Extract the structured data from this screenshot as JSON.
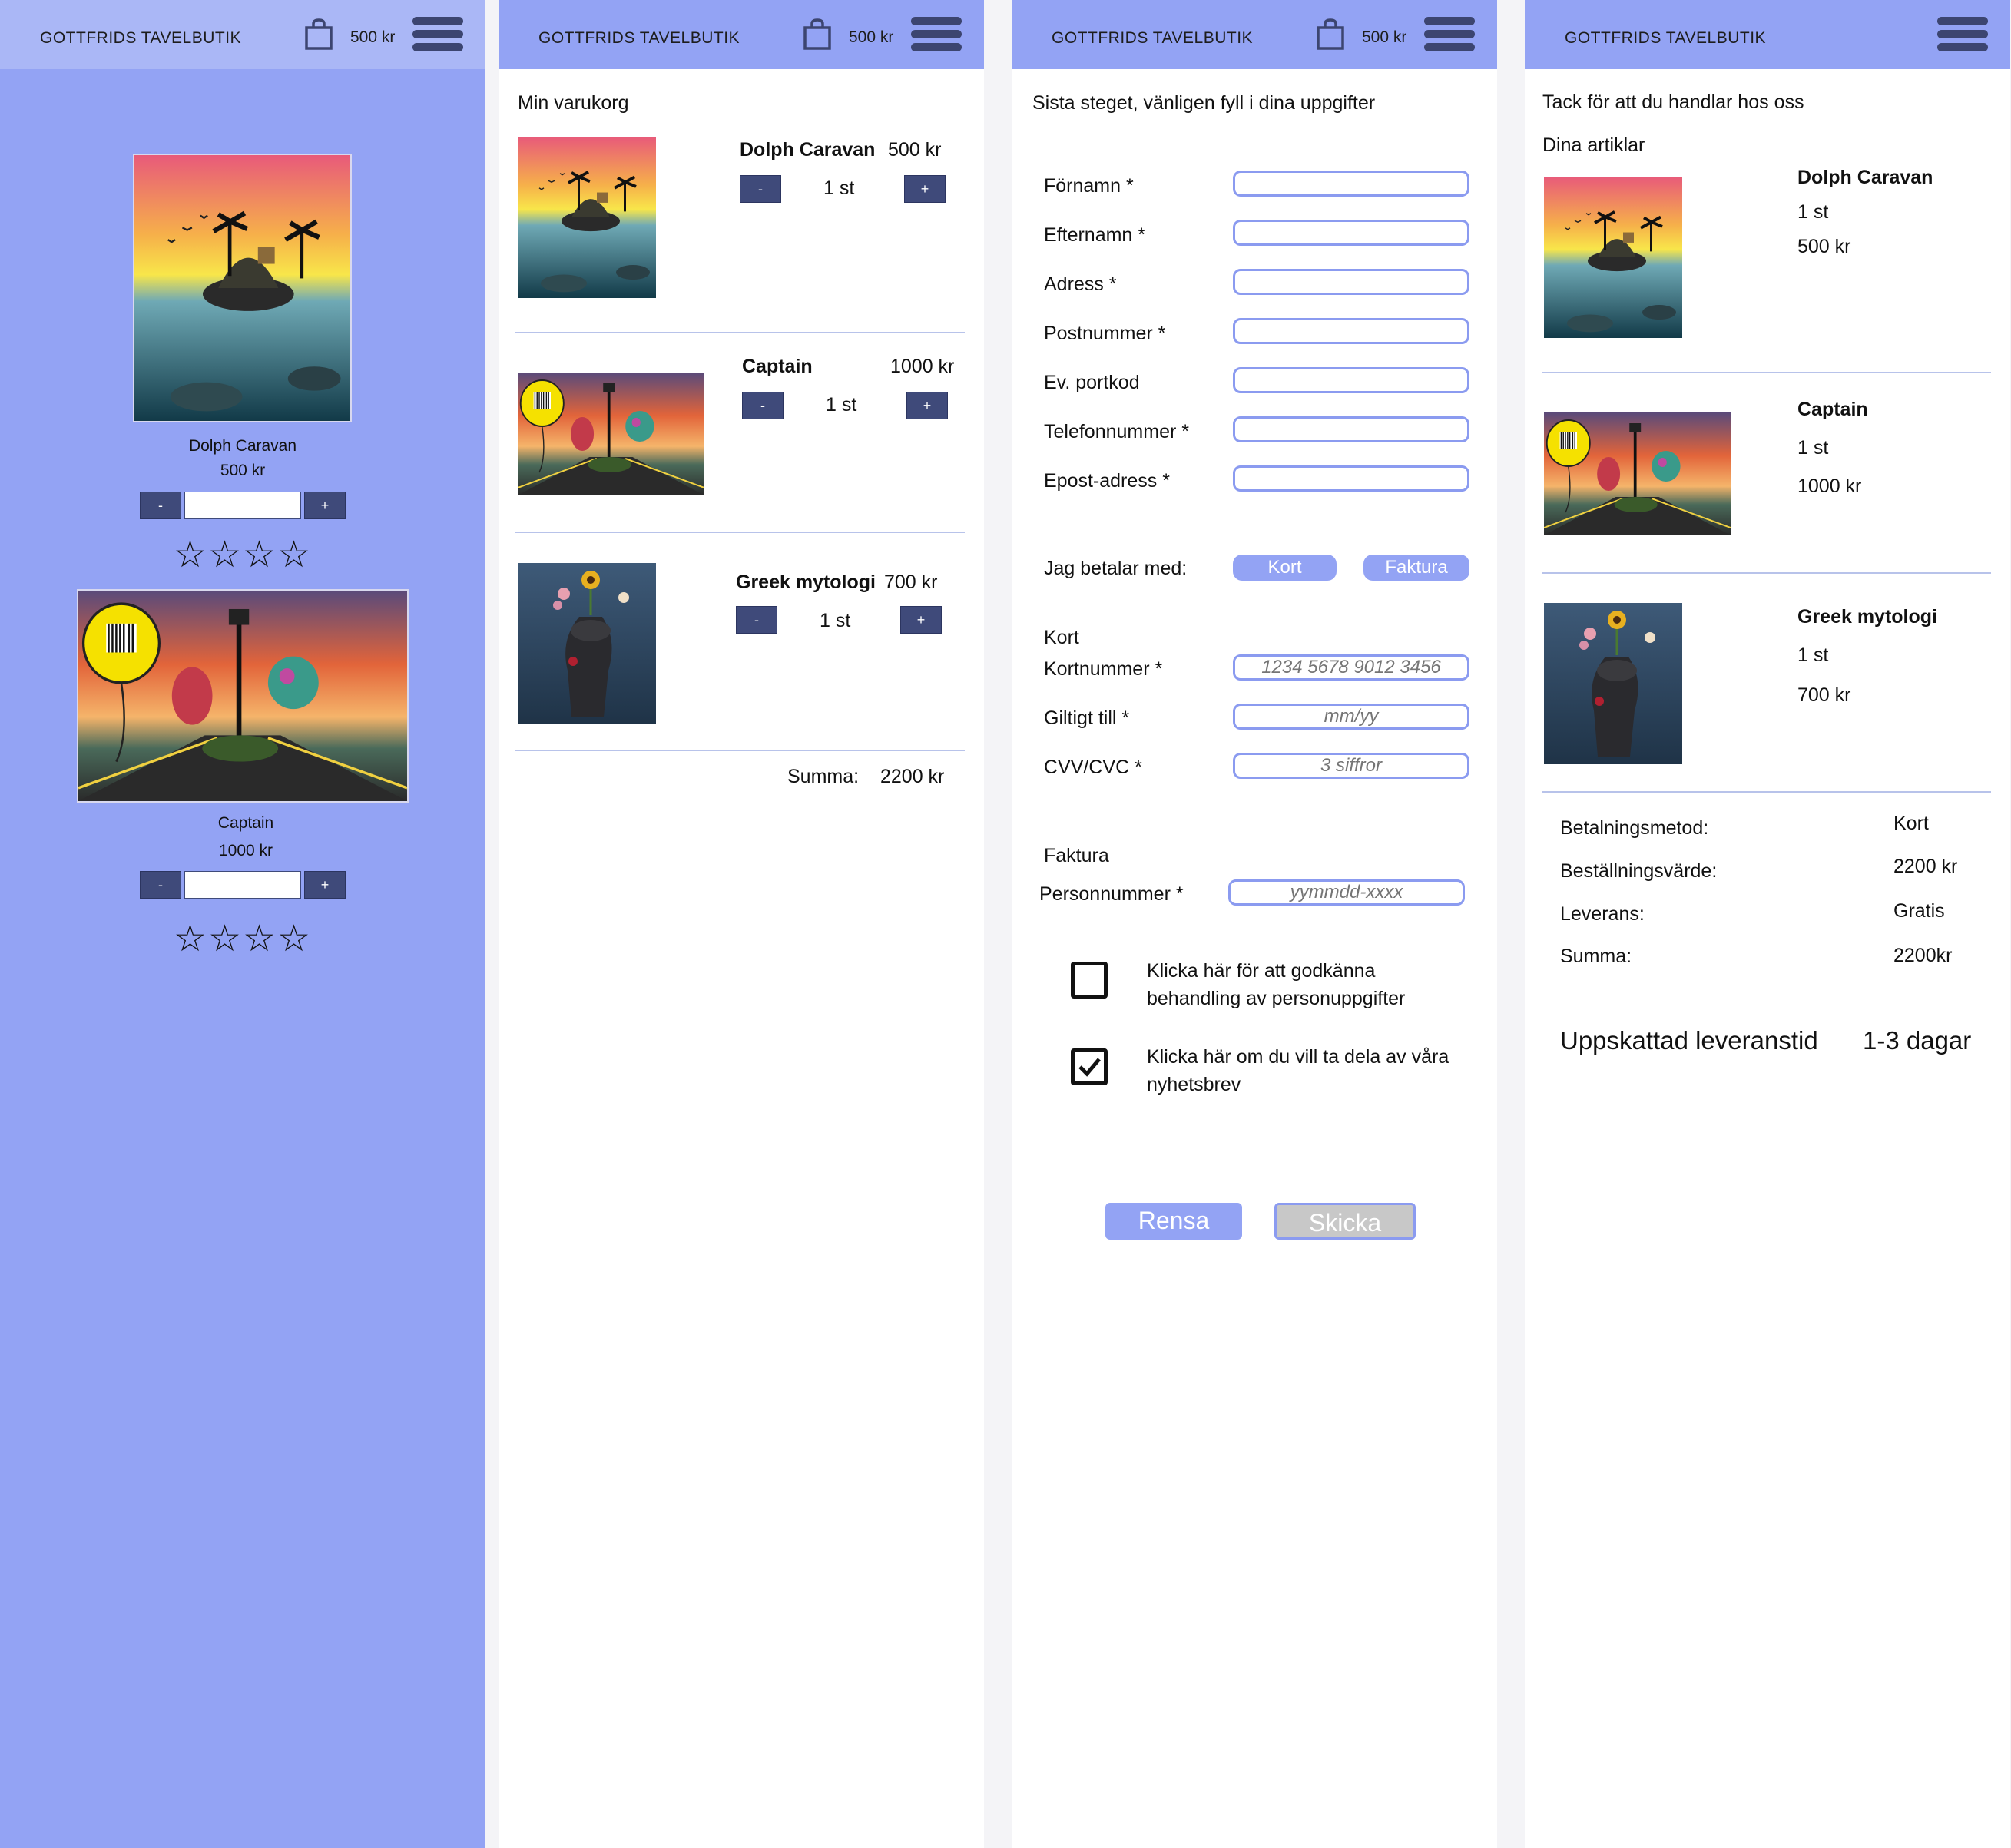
{
  "header": {
    "brand": "GOTTFRIDS TAVELBUTIK",
    "cart_total": "500 kr"
  },
  "products": {
    "dolph": {
      "name": "Dolph Caravan",
      "price": "500 kr"
    },
    "captain": {
      "name": "Captain",
      "price": "1000 kr"
    },
    "greek": {
      "name": "Greek mytologi",
      "price": "700 kr"
    }
  },
  "shop": {
    "minus": "-",
    "plus": "+",
    "rating_stars": "☆☆☆☆"
  },
  "cart": {
    "title": "Min varukorg",
    "qty": "1  st",
    "sum_label": "Summa:",
    "sum_value": "2200 kr"
  },
  "checkout": {
    "title": "Sista steget, vänligen fyll i dina uppgifter",
    "fields": {
      "first_name": "Förnamn *",
      "last_name": "Efternamn *",
      "address": "Adress *",
      "zip": "Postnummer *",
      "door_code": "Ev. portkod",
      "phone": "Telefonnummer *",
      "email": "Epost-adress *"
    },
    "pay_label": "Jag betalar med:",
    "pay_card": "Kort",
    "pay_invoice": "Faktura",
    "card_heading": "Kort",
    "card_number_label": "Kortnummer *",
    "card_number_placeholder": "1234 5678 9012 3456",
    "valid_label": "Giltigt till *",
    "valid_placeholder": "mm/yy",
    "cvv_label": "CVV/CVC *",
    "cvv_placeholder": "3 siffror",
    "invoice_heading": "Faktura",
    "personnummer_label": "Personnummer  *",
    "personnummer_placeholder": "yymmdd-xxxx",
    "consent_text_1": "Klicka här för att godkänna",
    "consent_text_2": "behandling av personuppgifter",
    "consent_checked": false,
    "newsletter_text_1": "Klicka här om du vill ta dela av våra",
    "newsletter_text_2": "nyhetsbrev",
    "newsletter_checked": true,
    "reset_label": "Rensa",
    "submit_label": "Skicka"
  },
  "confirmation": {
    "thanks": "Tack för att du handlar hos oss",
    "items_heading": "Dina artiklar",
    "qty": "1  st",
    "payment_method_label": "Betalningsmetod:",
    "payment_method_value": "Kort",
    "order_value_label": "Beställningsvärde:",
    "order_value_value": "2200 kr",
    "delivery_label": "Leverans:",
    "delivery_value": "Gratis",
    "sum_label": "Summa:",
    "sum_value": "2200kr",
    "eta_label": "Uppskattad leveranstid",
    "eta_value": "1-3 dagar"
  },
  "colors": {
    "accent": "#93a3f4",
    "dark_button": "#3f4a7a",
    "submit_disabled": "#c8c8c8"
  }
}
